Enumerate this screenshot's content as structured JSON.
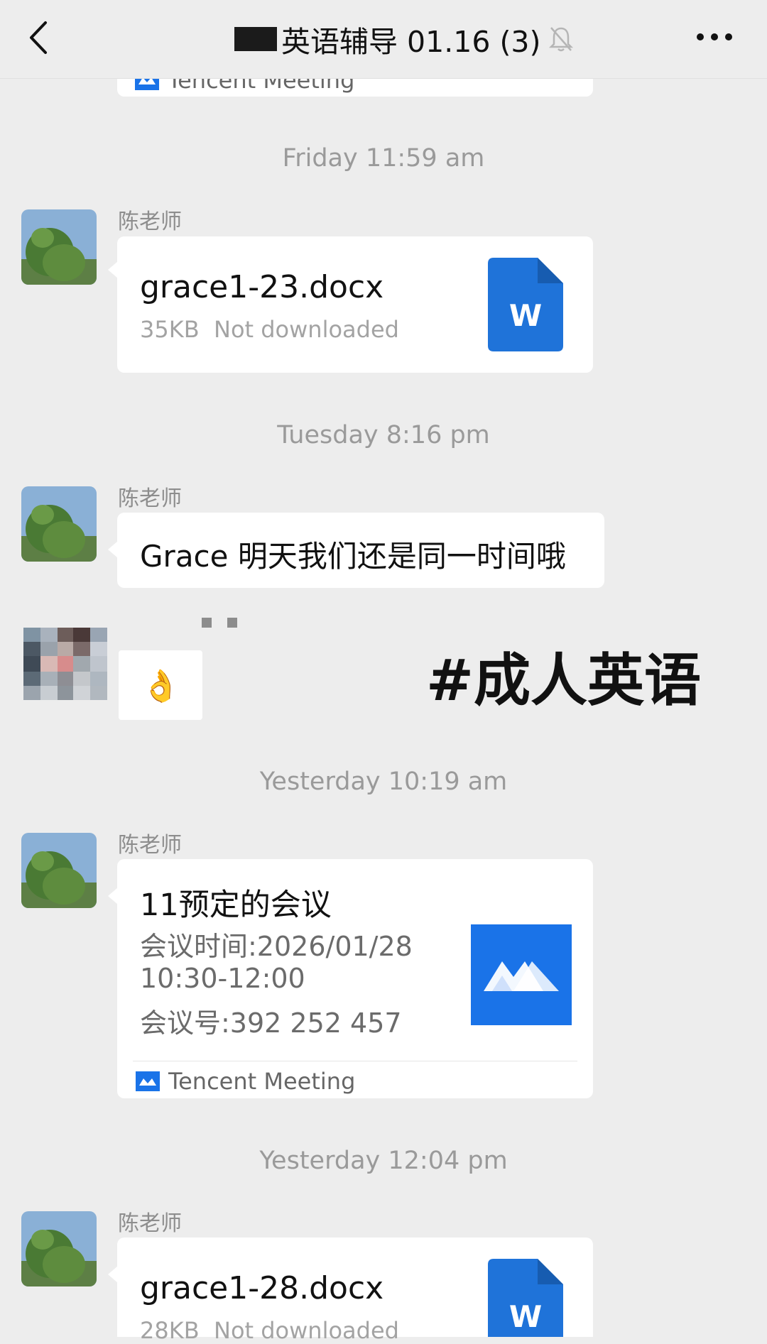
{
  "header": {
    "back_icon": "chevron-left-icon",
    "title": "英语辅导 01.16 (3)",
    "mute_icon": "bell-muted-icon",
    "more_icon": "more-dots-icon"
  },
  "partial_card": {
    "footer_label": "Tencent Meeting"
  },
  "messages": [
    {
      "timestamp": "Friday 11:59 am",
      "sender": "陈老师",
      "type": "file",
      "file_name": "grace1-23.docx",
      "size": "35KB",
      "status": "Not downloaded",
      "icon": "word-doc-icon",
      "icon_letter": "W"
    },
    {
      "timestamp": "Tuesday 8:16 pm",
      "sender": "陈老师",
      "type": "text",
      "text": "Grace 明天我们还是同一时间哦"
    },
    {
      "type": "emoji",
      "emoji": "👌"
    },
    {
      "timestamp": "Yesterday 10:19 am",
      "sender": "陈老师",
      "type": "meeting",
      "title": "11预定的会议",
      "lines": [
        "会议时间:2026/01/28",
        "10:30-12:00",
        "会议号:392 252 457"
      ],
      "footer_label": "Tencent Meeting",
      "icon": "tencent-meeting-icon"
    },
    {
      "timestamp": "Yesterday 12:04 pm",
      "sender": "陈老师",
      "type": "file",
      "file_name": "grace1-28.docx",
      "size": "28KB",
      "status": "Not downloaded",
      "icon": "word-doc-icon",
      "icon_letter": "W"
    }
  ],
  "overlay": {
    "hashtag": "#成人英语"
  },
  "colors": {
    "background": "#ededed",
    "word_blue": "#1f73d9",
    "meeting_blue": "#1a73e8"
  }
}
